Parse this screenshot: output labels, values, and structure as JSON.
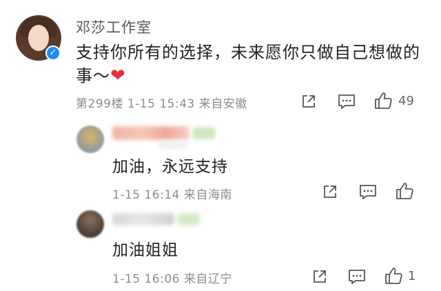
{
  "comment": {
    "author": "邓莎工作室",
    "text_line1": "支持你所有的选择，未来愿你只做自己想做的",
    "text_line2": "事～",
    "heart": "❤",
    "floor": "第299楼",
    "datetime": "1-15 15:43",
    "location": "来自安徽",
    "likes": "49",
    "icons": [
      "share-icon",
      "comment-icon",
      "like-icon"
    ]
  },
  "replies": [
    {
      "text": "加油，永远支持",
      "datetime": "1-15 16:14",
      "location": "来自海南",
      "likes": ""
    },
    {
      "text": "加油姐姐",
      "datetime": "1-15 16:06",
      "location": "来自辽宁",
      "likes": "1"
    }
  ],
  "colors": {
    "text": "#222222",
    "meta": "#8c8c8c",
    "verify": "#1a8cff",
    "heart": "#e8313e"
  }
}
